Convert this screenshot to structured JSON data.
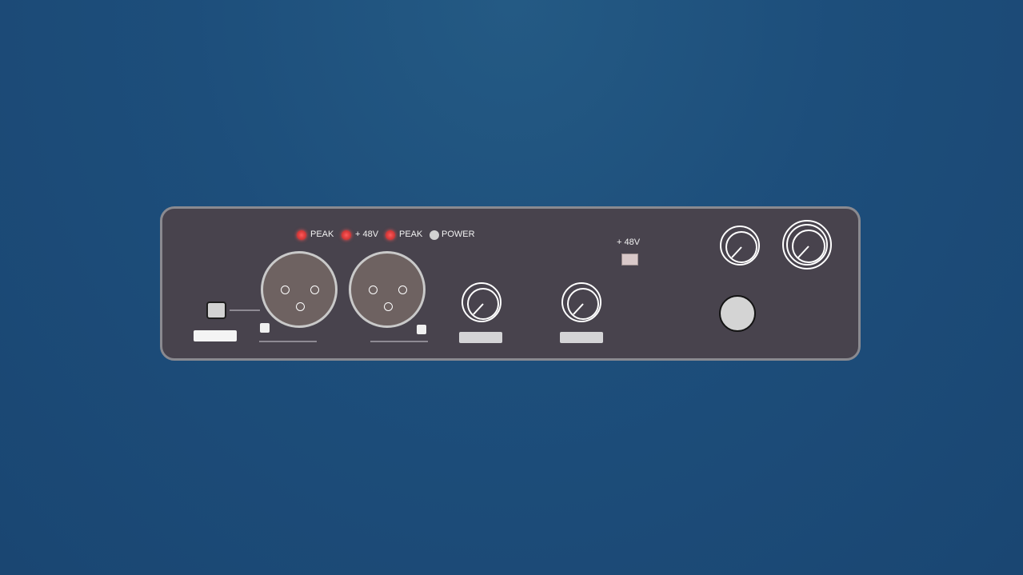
{
  "device": {
    "indicators": [
      {
        "label": "PEAK",
        "state": "on",
        "color": "#e04040"
      },
      {
        "label": "+ 48V",
        "state": "on",
        "color": "#e04040"
      },
      {
        "label": "PEAK",
        "state": "on",
        "color": "#e04040"
      },
      {
        "label": "POWER",
        "state": "off",
        "color": "#d2d2d2"
      }
    ],
    "phantom_label": "+ 48V",
    "colors": {
      "background": "#1d4e7b",
      "panel": "#48434d",
      "panel_border": "#8a8a90",
      "xlr_body": "#6e6261",
      "led_red": "#e04040"
    },
    "icons": {
      "xlr_input": "xlr-connector-icon",
      "knob": "rotary-knob-icon",
      "headphone_jack": "jack-socket-icon"
    }
  }
}
